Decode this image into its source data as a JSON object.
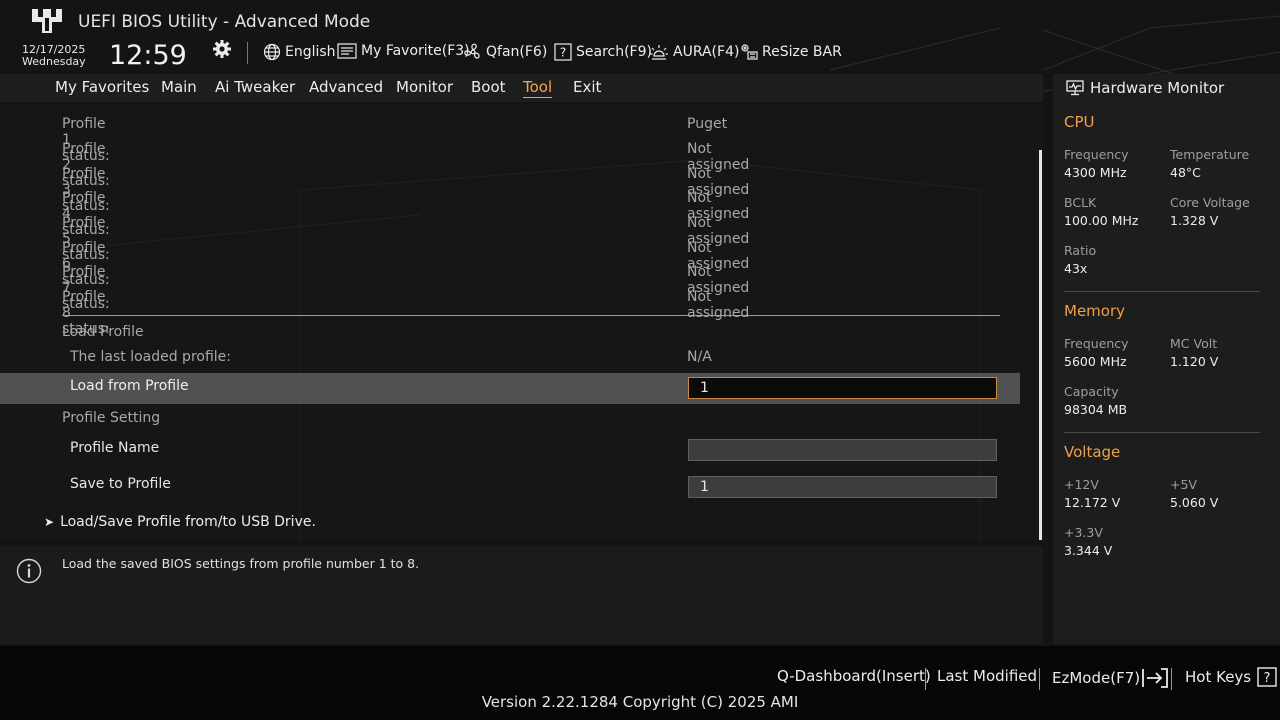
{
  "app": {
    "title": "UEFI BIOS Utility - Advanced Mode",
    "date": "12/17/2025",
    "weekday": "Wednesday",
    "time": "12:59"
  },
  "toolbar": {
    "language": "English",
    "favorite": "My Favorite(F3)",
    "qfan": "Qfan(F6)",
    "search": "Search(F9)",
    "aura": "AURA(F4)",
    "resize_bar": "ReSize BAR"
  },
  "tabs": [
    "My Favorites",
    "Main",
    "Ai Tweaker",
    "Advanced",
    "Monitor",
    "Boot",
    "Tool",
    "Exit"
  ],
  "active_tab": "Tool",
  "profiles": [
    {
      "label": "Profile 1 status:",
      "value": "Puget"
    },
    {
      "label": "Profile 2 status:",
      "value": "Not assigned"
    },
    {
      "label": "Profile 3 status:",
      "value": "Not assigned"
    },
    {
      "label": "Profile 4 status:",
      "value": "Not assigned"
    },
    {
      "label": "Profile 5 status:",
      "value": "Not assigned"
    },
    {
      "label": "Profile 6 status:",
      "value": "Not assigned"
    },
    {
      "label": "Profile 7 status:",
      "value": "Not assigned"
    },
    {
      "label": "Profile 8 status:",
      "value": "Not assigned"
    }
  ],
  "load_profile": {
    "heading": "Load Profile",
    "last_loaded_label": "The last loaded profile:",
    "last_loaded_value": "N/A",
    "load_from_label": "Load from Profile",
    "load_from_value": "1"
  },
  "profile_setting": {
    "heading": "Profile Setting",
    "name_label": "Profile Name",
    "name_value": "",
    "save_label": "Save to Profile",
    "save_value": "1"
  },
  "usb_link": "Load/Save Profile from/to USB Drive.",
  "help_text": "Load the saved BIOS settings from profile number 1 to 8.",
  "hardware_monitor": {
    "title": "Hardware Monitor",
    "cpu": {
      "heading": "CPU",
      "frequency_label": "Frequency",
      "frequency": "4300 MHz",
      "temperature_label": "Temperature",
      "temperature": "48°C",
      "bclk_label": "BCLK",
      "bclk": "100.00 MHz",
      "core_voltage_label": "Core Voltage",
      "core_voltage": "1.328 V",
      "ratio_label": "Ratio",
      "ratio": "43x"
    },
    "memory": {
      "heading": "Memory",
      "frequency_label": "Frequency",
      "frequency": "5600 MHz",
      "mc_volt_label": "MC Volt",
      "mc_volt": "1.120 V",
      "capacity_label": "Capacity",
      "capacity": "98304 MB"
    },
    "voltage": {
      "heading": "Voltage",
      "v12_label": "+12V",
      "v12": "12.172 V",
      "v5_label": "+5V",
      "v5": "5.060 V",
      "v33_label": "+3.3V",
      "v33": "3.344 V"
    }
  },
  "bottom": {
    "q_dashboard": "Q-Dashboard(Insert)",
    "last_modified": "Last Modified",
    "ezmode": "EzMode(F7)",
    "hot_keys": "Hot Keys",
    "version": "Version 2.22.1284 Copyright (C) 2025 AMI"
  },
  "colors": {
    "accent": "#f5a44a",
    "background": "#141414",
    "selected_row": "#515151"
  }
}
